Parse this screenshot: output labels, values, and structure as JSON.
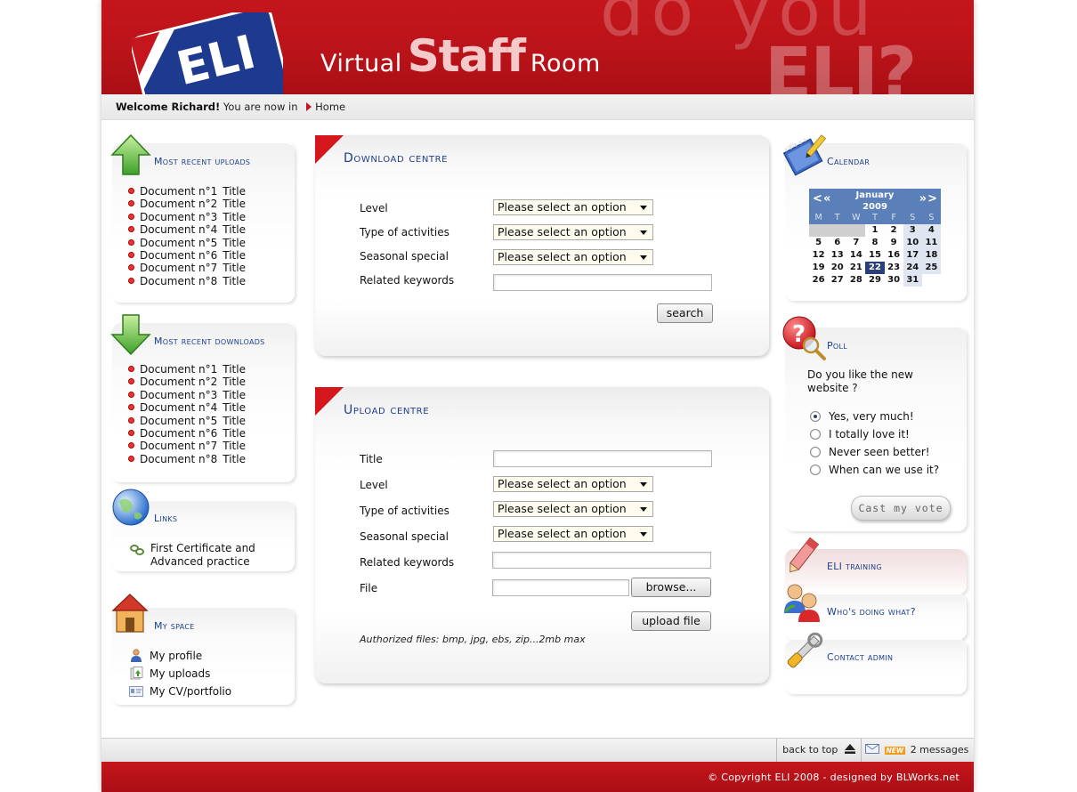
{
  "header": {
    "logo_text": "ELI",
    "title_virtual": "Virtual",
    "title_staff": "Staff",
    "title_room": "Room",
    "slogan_line1": "do you",
    "slogan_line2": "ELI?"
  },
  "breadcrumb": {
    "welcome": "Welcome Richard!",
    "you_are_in": "You are now in",
    "current": "Home"
  },
  "recent_uploads": {
    "title": "Most recent uploads",
    "items": [
      {
        "doc": "Document n°1",
        "title": "Title"
      },
      {
        "doc": "Document n°2",
        "title": "Title"
      },
      {
        "doc": "Document n°3",
        "title": "Title"
      },
      {
        "doc": "Document n°4",
        "title": "Title"
      },
      {
        "doc": "Document n°5",
        "title": "Title"
      },
      {
        "doc": "Document n°6",
        "title": "Title"
      },
      {
        "doc": "Document n°7",
        "title": "Title"
      },
      {
        "doc": "Document n°8",
        "title": "Title"
      }
    ]
  },
  "recent_downloads": {
    "title": "Most recent downloads",
    "items": [
      {
        "doc": "Document n°1",
        "title": "Title"
      },
      {
        "doc": "Document n°2",
        "title": "Title"
      },
      {
        "doc": "Document n°3",
        "title": "Title"
      },
      {
        "doc": "Document n°4",
        "title": "Title"
      },
      {
        "doc": "Document n°5",
        "title": "Title"
      },
      {
        "doc": "Document n°6",
        "title": "Title"
      },
      {
        "doc": "Document n°7",
        "title": "Title"
      },
      {
        "doc": "Document n°8",
        "title": "Title"
      }
    ]
  },
  "links": {
    "title": "Links",
    "item_line1": "First Certificate and",
    "item_line2": "Advanced practice"
  },
  "my_space": {
    "title": "My space",
    "profile": "My profile",
    "uploads": "My uploads",
    "cv": "My CV/portfolio"
  },
  "download_centre": {
    "title": "Download centre",
    "level_label": "Level",
    "type_label": "Type of activities",
    "seasonal_label": "Seasonal special",
    "keywords_label": "Related keywords",
    "level_value": "Please select an option",
    "type_value": "Please select an option",
    "seasonal_value": "Please select an option",
    "keywords_value": "",
    "search_button": "search"
  },
  "upload_centre": {
    "title": "Upload centre",
    "title_label": "Title",
    "level_label": "Level",
    "type_label": "Type of activities",
    "seasonal_label": "Seasonal special",
    "keywords_label": "Related keywords",
    "file_label": "File",
    "title_value": "",
    "level_value": "Please select an option",
    "type_value": "Please select an option",
    "seasonal_value": "Please select an option",
    "keywords_value": "",
    "file_value": "",
    "browse_button": "browse...",
    "upload_button": "upload file",
    "note": "Authorized files: bmp, jpg, ebs, zip...2mb max"
  },
  "calendar": {
    "title": "Calendar",
    "month": "January",
    "year": "2009",
    "prev_month": "<",
    "prev_year": "«",
    "next_year": "»",
    "next_month": ">",
    "weekdays": [
      "M",
      "T",
      "W",
      "T",
      "F",
      "S",
      "S"
    ],
    "weeks": [
      [
        "",
        "",
        "",
        "1",
        "2",
        "3",
        "4"
      ],
      [
        "5",
        "6",
        "7",
        "8",
        "9",
        "10",
        "11"
      ],
      [
        "12",
        "13",
        "14",
        "15",
        "16",
        "17",
        "18"
      ],
      [
        "19",
        "20",
        "21",
        "22",
        "23",
        "24",
        "25"
      ],
      [
        "26",
        "27",
        "28",
        "29",
        "30",
        "31",
        ""
      ]
    ],
    "today": "22"
  },
  "poll": {
    "title": "Poll",
    "question_line1": "Do you like the new",
    "question_line2": "website ?",
    "options": [
      "Yes, very much!",
      "I totally love it!",
      "Never seen better!",
      "When can we use it?"
    ],
    "selected_index": 0,
    "vote_button": "Cast my vote"
  },
  "quicklinks": {
    "eli_training": "ELI training",
    "whos_doing": "Who's doing what?",
    "contact_admin": "Contact admin"
  },
  "bottombar": {
    "back_to_top": "back to top",
    "new_badge": "NEW",
    "messages": "2 messages"
  },
  "footer": {
    "copyright": "© Copyright ELI 2008 - designed by BLWorks.net"
  },
  "colors": {
    "brand_red": "#c4161c",
    "title_blue": "#1e3f8c",
    "calendar_blue": "#5b7fb8",
    "today_navy": "#2a3f7a"
  }
}
